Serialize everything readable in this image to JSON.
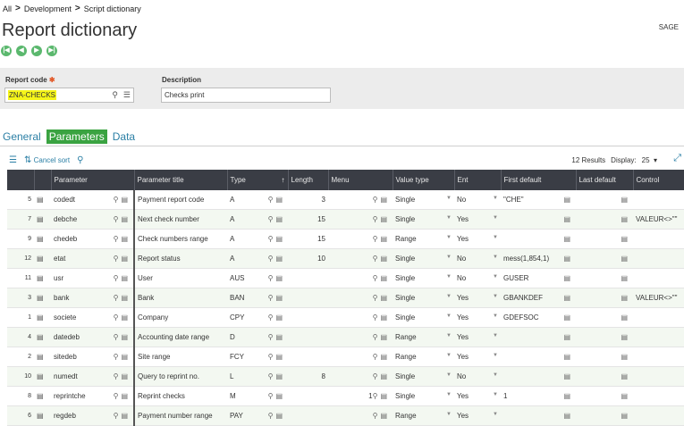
{
  "breadcrumb": [
    "All",
    "Development",
    "Script dictionary"
  ],
  "page_title": "Report dictionary",
  "user_label": "SAGE",
  "form": {
    "report_code_label": "Report code",
    "report_code_value": "ZNA-CHECKS",
    "description_label": "Description",
    "description_value": "Checks print"
  },
  "tabs": [
    "General",
    "Parameters",
    "Data"
  ],
  "toolbar": {
    "cancel_sort": "Cancel sort"
  },
  "results": {
    "count": "12 Results",
    "display_label": "Display:",
    "display_value": "25"
  },
  "columns": [
    "Parameter",
    "Parameter title",
    "Type",
    "Length",
    "Menu",
    "Value type",
    "Ent",
    "First default",
    "Last default",
    "Control"
  ],
  "rows": [
    {
      "n": "5",
      "param": "codedt",
      "title": "Payment report code",
      "type": "A",
      "length": "3",
      "menu": "",
      "vtype": "Single",
      "ent": "No",
      "first": "\"CHE\"",
      "last": "",
      "control": ""
    },
    {
      "n": "7",
      "param": "debche",
      "title": "Next check number",
      "type": "A",
      "length": "15",
      "menu": "",
      "vtype": "Single",
      "ent": "Yes",
      "first": "",
      "last": "",
      "control": "VALEUR<>\"\""
    },
    {
      "n": "9",
      "param": "chedeb",
      "title": "Check numbers range",
      "type": "A",
      "length": "15",
      "menu": "",
      "vtype": "Range",
      "ent": "Yes",
      "first": "",
      "last": "",
      "control": ""
    },
    {
      "n": "12",
      "param": "etat",
      "title": "Report status",
      "type": "A",
      "length": "10",
      "menu": "",
      "vtype": "Single",
      "ent": "No",
      "first": "mess(1,854,1)",
      "last": "",
      "control": ""
    },
    {
      "n": "11",
      "param": "usr",
      "title": "User",
      "type": "AUS",
      "length": "",
      "menu": "",
      "vtype": "Single",
      "ent": "No",
      "first": "GUSER",
      "last": "",
      "control": ""
    },
    {
      "n": "3",
      "param": "bank",
      "title": "Bank",
      "type": "BAN",
      "length": "",
      "menu": "",
      "vtype": "Single",
      "ent": "Yes",
      "first": "GBANKDEF",
      "last": "",
      "control": "VALEUR<>\"\""
    },
    {
      "n": "1",
      "param": "societe",
      "title": "Company",
      "type": "CPY",
      "length": "",
      "menu": "",
      "vtype": "Single",
      "ent": "Yes",
      "first": "GDEFSOC",
      "last": "",
      "control": ""
    },
    {
      "n": "4",
      "param": "datedeb",
      "title": "Accounting date range",
      "type": "D",
      "length": "",
      "menu": "",
      "vtype": "Range",
      "ent": "Yes",
      "first": "",
      "last": "",
      "control": ""
    },
    {
      "n": "2",
      "param": "sitedeb",
      "title": "Site range",
      "type": "FCY",
      "length": "",
      "menu": "",
      "vtype": "Range",
      "ent": "Yes",
      "first": "",
      "last": "",
      "control": ""
    },
    {
      "n": "10",
      "param": "numedt",
      "title": "Query to reprint no.",
      "type": "L",
      "length": "8",
      "menu": "",
      "vtype": "Single",
      "ent": "No",
      "first": "",
      "last": "",
      "control": ""
    },
    {
      "n": "8",
      "param": "reprintche",
      "title": "Reprint checks",
      "type": "M",
      "length": "",
      "menu": "1",
      "vtype": "Single",
      "ent": "Yes",
      "first": "1",
      "last": "",
      "control": ""
    },
    {
      "n": "6",
      "param": "regdeb",
      "title": "Payment number range",
      "type": "PAY",
      "length": "",
      "menu": "",
      "vtype": "Range",
      "ent": "Yes",
      "first": "",
      "last": "",
      "control": ""
    }
  ]
}
